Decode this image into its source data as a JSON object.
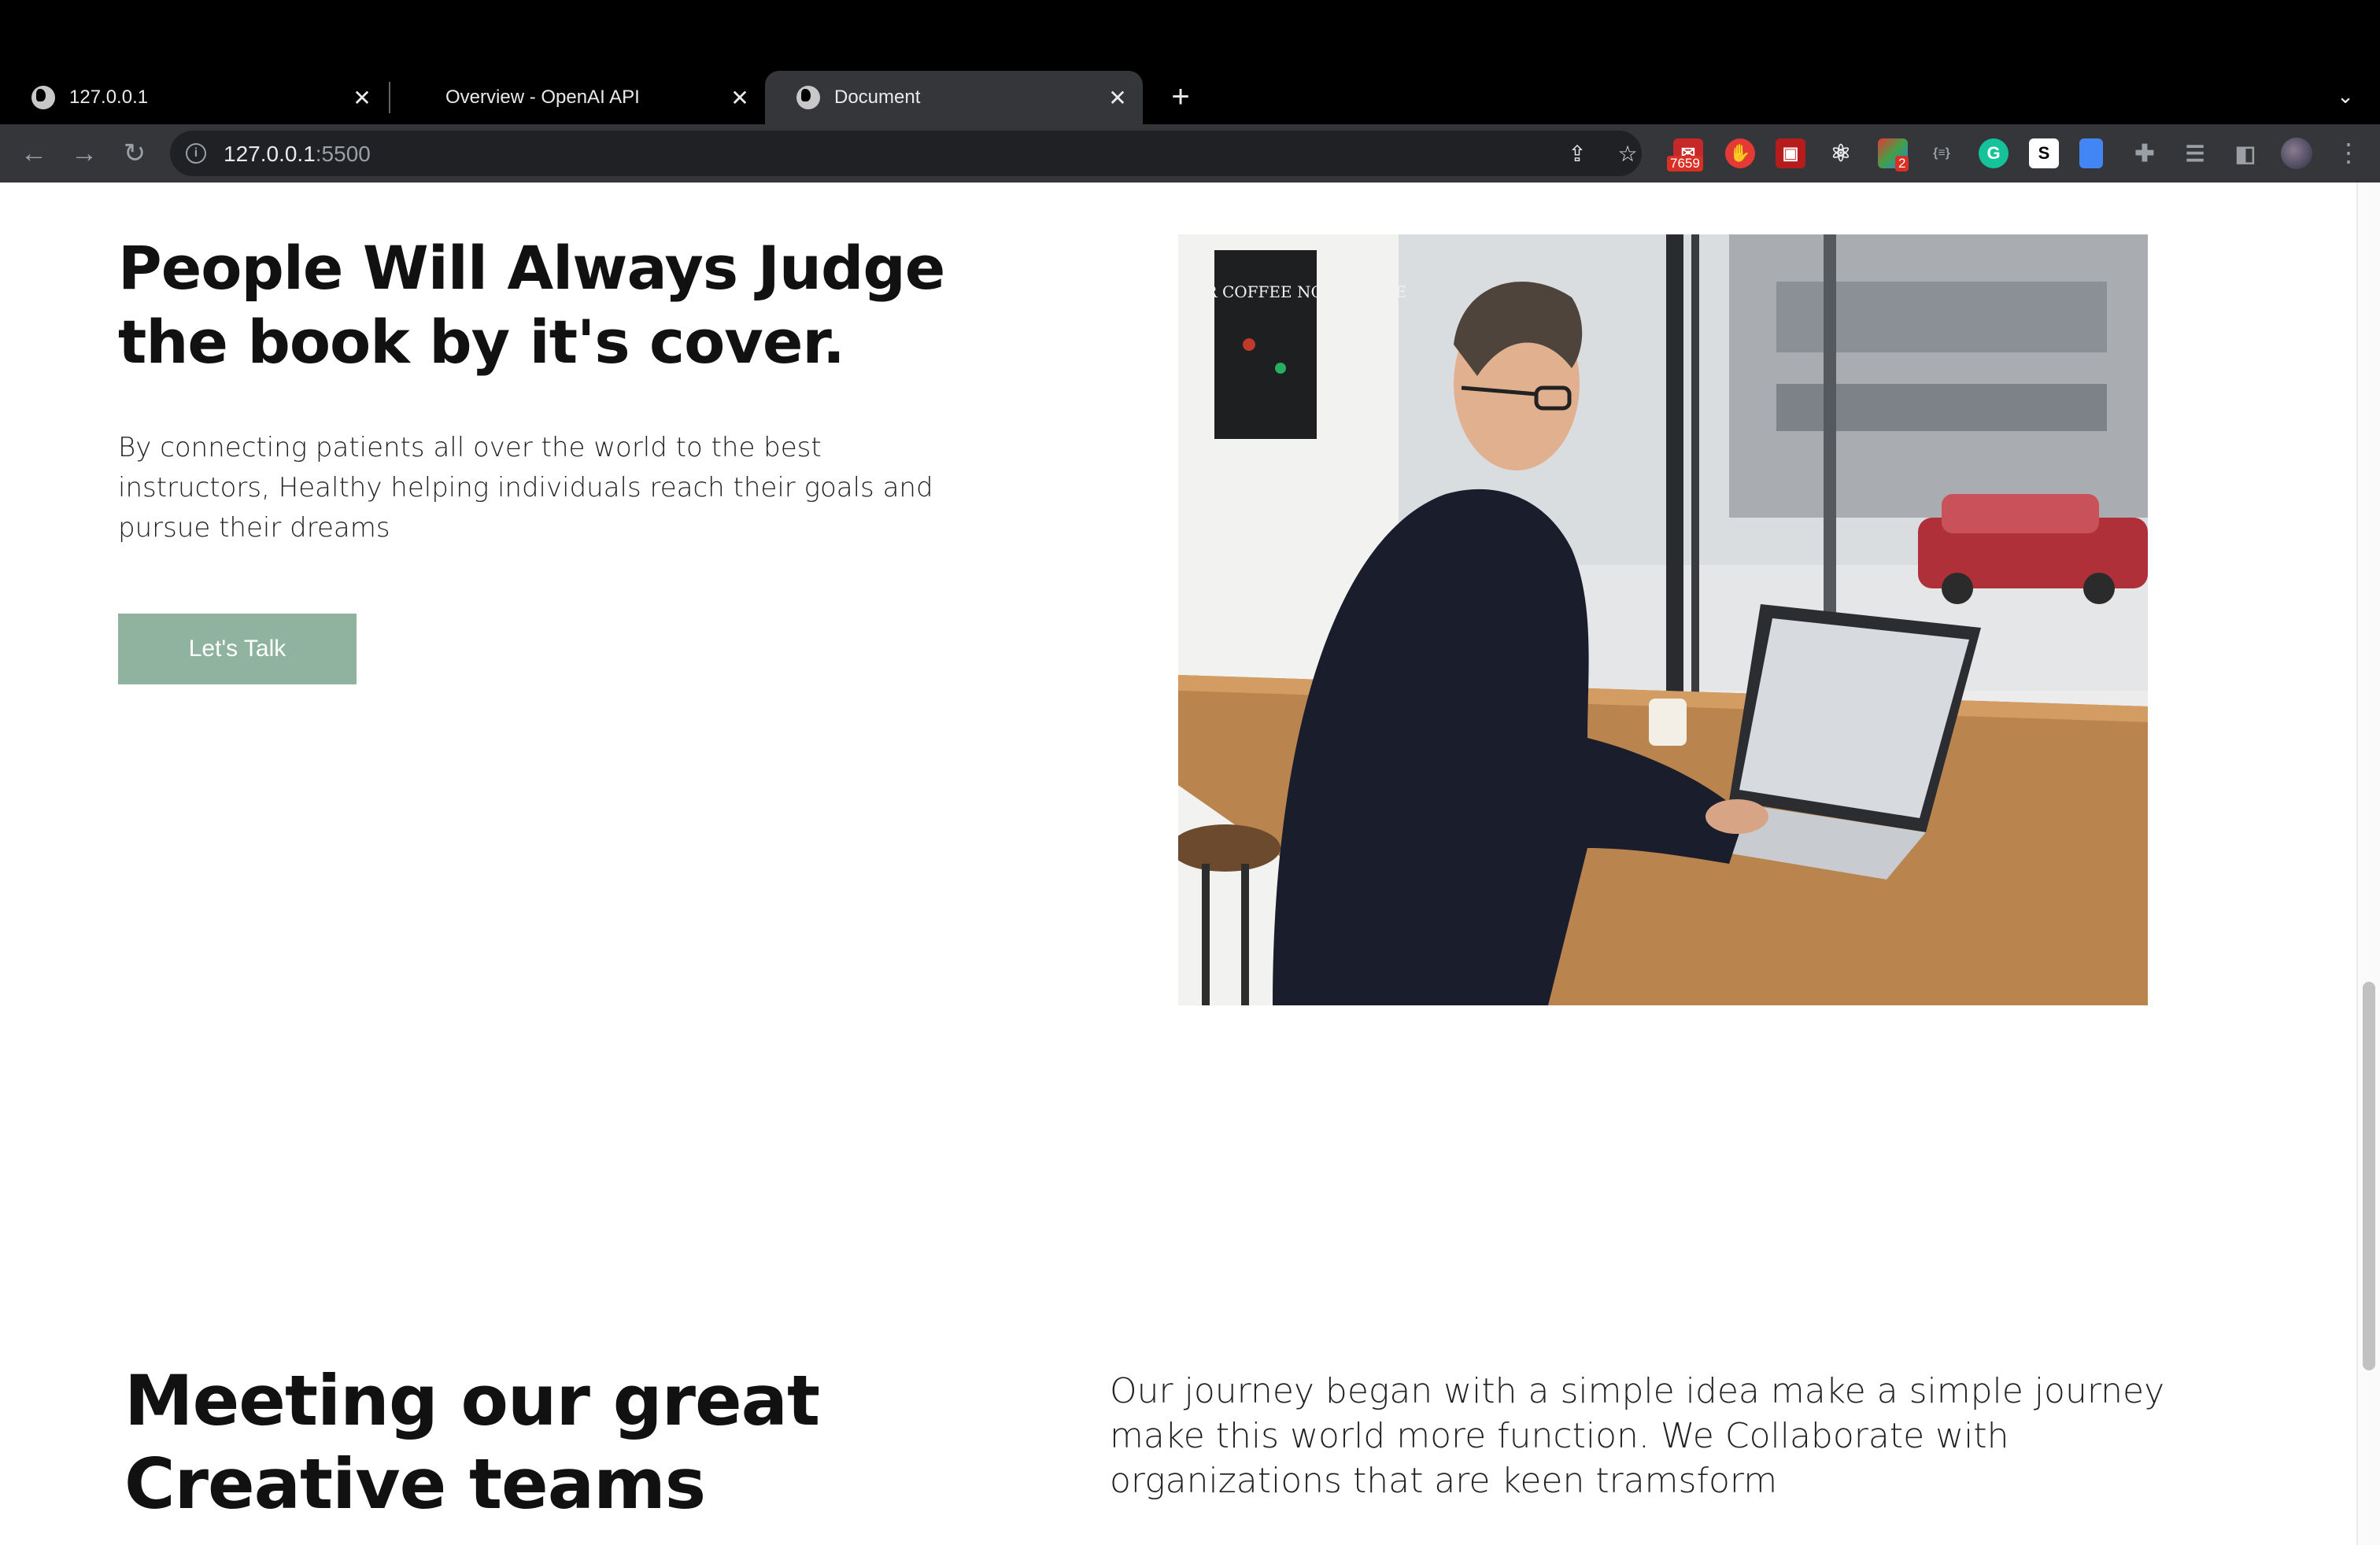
{
  "browser": {
    "tabs": [
      {
        "title": "127.0.0.1",
        "active": false
      },
      {
        "title": "Overview - OpenAI API",
        "active": false
      },
      {
        "title": "Document",
        "active": true
      }
    ],
    "url_host": "127.0.0.1",
    "url_port": ":5500",
    "extensions": [
      {
        "name": "mail-extension",
        "badge": "7659",
        "color": "#d93025"
      },
      {
        "name": "adblock-extension",
        "color": "#e53935"
      },
      {
        "name": "image-extension",
        "color": "#c62828"
      },
      {
        "name": "react-devtools-extension",
        "color": "#61dafb"
      },
      {
        "name": "multicolor-extension",
        "badge": "2",
        "color": "#8e44ad"
      },
      {
        "name": "json-extension",
        "label": "{≡}",
        "color": "#5f6368"
      },
      {
        "name": "grammarly-extension",
        "label": "G",
        "color": "#15c39a"
      },
      {
        "name": "s-extension",
        "label": "S",
        "color": "#ffffff"
      },
      {
        "name": "docs-extension",
        "color": "#4285f4"
      }
    ]
  },
  "hero": {
    "title": "People Will Always Judge the book by it's cover.",
    "text": "By connecting patients all over the world to the best instructors, Healthy helping individuals reach their goals and pursue their dreams",
    "cta_label": "Let's Talk"
  },
  "poster_text": "WE FILTER COFFEE NOT PEOPLE",
  "team": {
    "title": "Meeting our great Creative teams",
    "text": "Our journey began with a simple idea make a simple journey make this world more function. We Collaborate with organizations that are keen tramsform"
  }
}
